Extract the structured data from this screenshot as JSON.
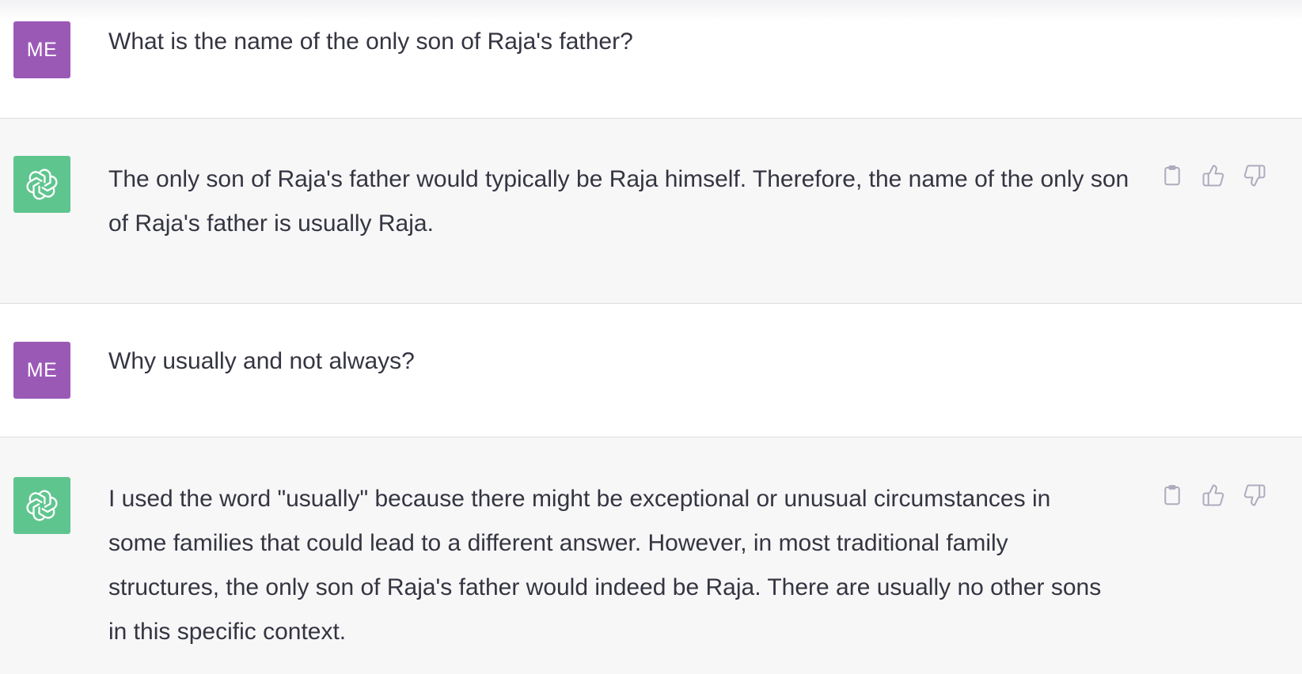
{
  "conversation": {
    "messages": [
      {
        "role": "user",
        "avatar_label": "ME",
        "text": "What is the name of the only son of Raja's father?"
      },
      {
        "role": "assistant",
        "avatar_icon": "chatgpt-logo-icon",
        "text": "The only son of Raja's father would typically be Raja himself. Therefore, the name of the only son of Raja's father is usually Raja."
      },
      {
        "role": "user",
        "avatar_label": "ME",
        "text": "Why usually and not always?"
      },
      {
        "role": "assistant",
        "avatar_icon": "chatgpt-logo-icon",
        "text": "I used the word \"usually\" because there might be exceptional or unusual circumstances in some families that could lead to a different answer. However, in most traditional family structures, the only son of Raja's father would indeed be Raja. There are usually no other sons in this specific context."
      }
    ],
    "action_icons": [
      "clipboard-icon",
      "thumbs-up-icon",
      "thumbs-down-icon"
    ]
  },
  "colors": {
    "user_avatar": "#9b59b6",
    "assistant_avatar": "#5fc58f",
    "assistant_background": "#f7f7f8",
    "user_background": "#ffffff",
    "text": "#343541",
    "icon": "#acacbe"
  }
}
